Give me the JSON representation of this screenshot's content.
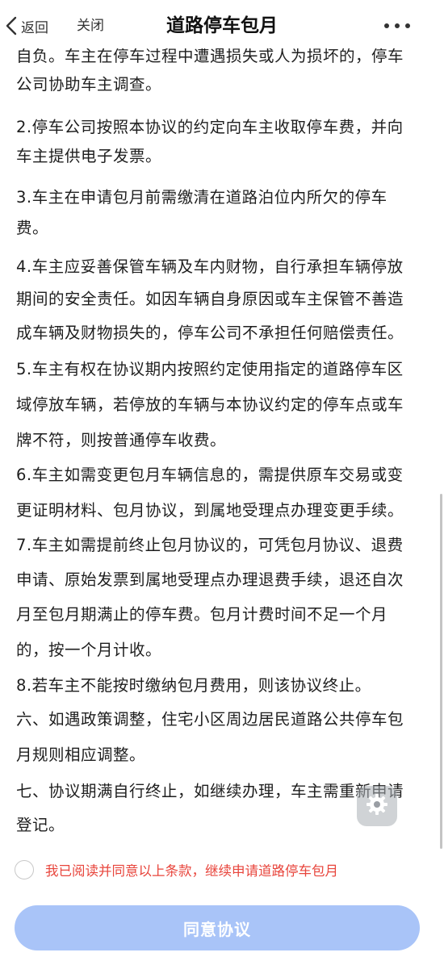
{
  "navbar": {
    "back_label": "返回",
    "close_label": "关闭",
    "title": "道路停车包月",
    "more_icon": "more-dots-icon"
  },
  "content": {
    "lines": [
      "自负。车主在停车过程中遭遇损失或人为损坏的，停车",
      "公司协助车主调查。",
      "2.停车公司按照本协议的约定向车主收取停车费，并向",
      "车主提供电子发票。",
      "3.车主在申请包月前需缴清在道路泊位内所欠的停车",
      "费。",
      "4.车主应妥善保管车辆及车内财物，自行承担车辆停放",
      "期间的安全责任。如因车辆自身原因或车主保管不善造",
      "成车辆及财物损失的，停车公司不承担任何赔偿责任。",
      "5.车主有权在协议期内按照约定使用指定的道路停车区",
      "域停放车辆，若停放的车辆与本协议约定的停车点或车",
      "牌不符，则按普通停车收费。",
      "6.车主如需变更包月车辆信息的，需提供原车交易或变",
      "更证明材料、包月协议，到属地受理点办理变更手续。",
      "7.车主如需提前终止包月协议的，可凭包月协议、退费",
      "申请、原始发票到属地受理点办理退费手续，退还自次",
      "月至包月期满止的停车费。包月计费时间不足一个月",
      "的，按一个月计收。",
      "8.若车主不能按时缴纳包月费用，则该协议终止。",
      "六、如遇政策调整，住宅小区周边居民道路公共停车包",
      "月规则相应调整。",
      "七、协议期满自行终止，如继续办理，车主需重新申请",
      "登记。"
    ]
  },
  "agreement": {
    "checkbox_text": "我已阅读并同意以上条款，继续申请道路停车包月",
    "checked": false,
    "accent_color": "#e8453c"
  },
  "submit_button": {
    "label": "同意协议",
    "color": "#a9c4f8"
  },
  "floating_button": {
    "icon": "gear-icon"
  }
}
